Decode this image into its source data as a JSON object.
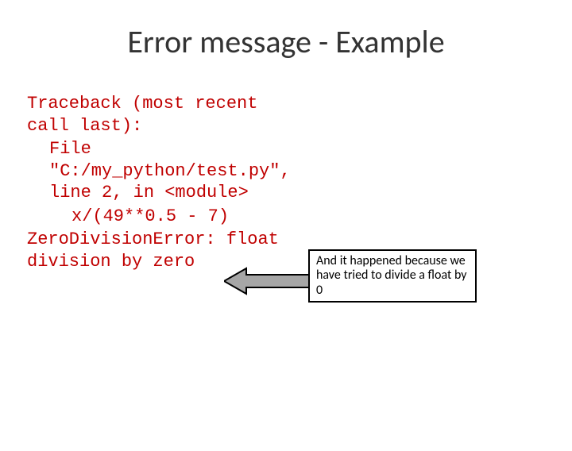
{
  "title": "Error message - Example",
  "code": {
    "l1": "Traceback (most recent call last):",
    "l2": "File \"C:/my_python/test.py\", line 2, in <module>",
    "l3": "x/(49**0.5 - 7)",
    "l4": "ZeroDivisionError: float division by zero"
  },
  "callout": {
    "text": "And it happened because we have tried to divide a float by 0"
  }
}
